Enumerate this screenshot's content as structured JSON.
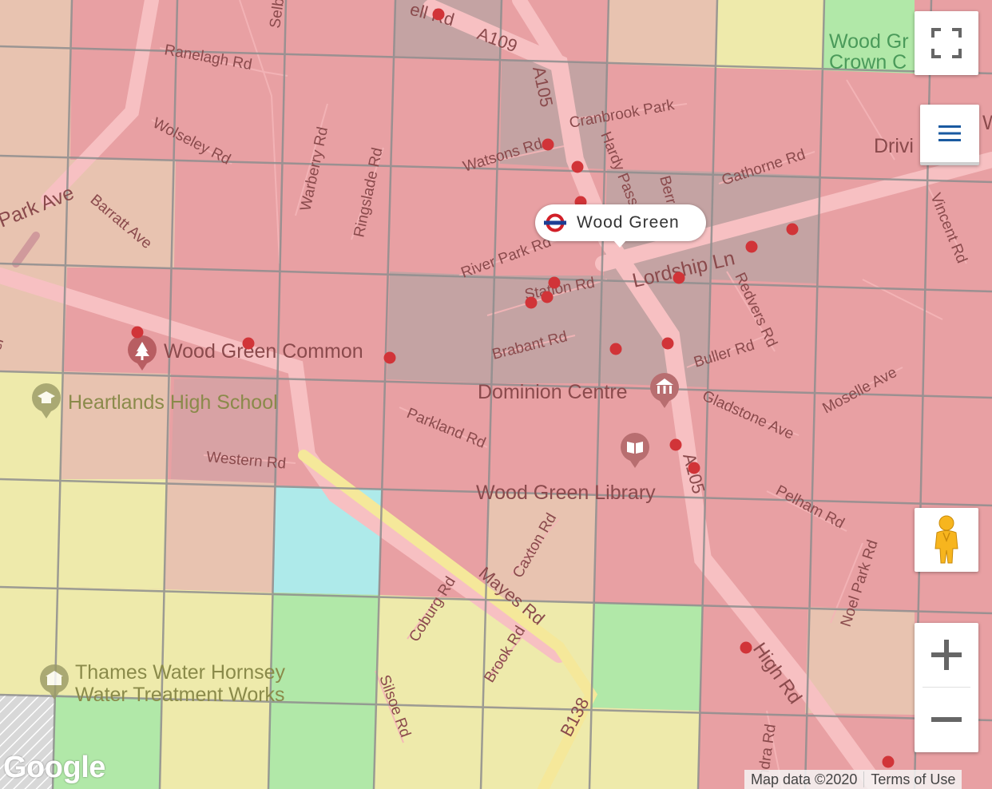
{
  "map": {
    "colors": {
      "red": "#e8a0a3",
      "dark": "#c4a3a3",
      "peach": "#e8c3b0",
      "yellow": "#eeeaab",
      "green": "#b1e8a8",
      "cyan": "#aeeaea",
      "grid": "#8e8e8e",
      "road": "#f5b9bb",
      "incident": "#d13438"
    },
    "road_labels": [
      "Ranelagh Rd",
      "Wolseley Rd",
      "Park Ave",
      "Barratt Ave",
      "Warberry Rd",
      "Ringslade Rd",
      "A109",
      "A105",
      "Cranbrook Park",
      "Watsons Rd",
      "Hardy Pass",
      "Gathorne Rd",
      "River Park Rd",
      "Station Rd",
      "Lordship Ln",
      "Redvers Rd",
      "Brabant Rd",
      "Buller Rd",
      "Gladstone Ave",
      "Moselle Ave",
      "Vincent Rd",
      "Parkland Rd",
      "Western Rd",
      "A105",
      "Pelham Rd",
      "Caxton Rd",
      "Mayes Rd",
      "Coburg Rd",
      "Noel Park Rd",
      "Brook Rd",
      "B138",
      "Silsoe Rd",
      "High Rd",
      "andra Rd",
      "Selb",
      "ell Rd",
      "Berr",
      "Drivi",
      "er"
    ],
    "poi_labels": {
      "wood_green_common": "Wood Green Common",
      "heartlands": "Heartlands High School",
      "dominion": "Dominion Centre",
      "library": "Wood Green Library",
      "thames_line1": "Thames Water Hornsey",
      "thames_line2": "Water Treatment Works",
      "crown_line1": "Wood Gr",
      "crown_line2": "Crown C",
      "right_edge": "Wood"
    },
    "icons": [
      "park-pin-icon",
      "school-pin-icon",
      "theatre-pin-icon",
      "library-pin-icon",
      "facility-pin-icon",
      "underground-roundel-icon"
    ]
  },
  "station": {
    "name": "Wood Green"
  },
  "controls": {
    "fullscreen": "fullscreen-icon",
    "layers": "menu-icon",
    "pegman": "pegman-icon",
    "zoom_in": "+",
    "zoom_out": "−"
  },
  "attribution": {
    "logo": "Google",
    "map_data": "Map data ©2020",
    "terms": "Terms of Use"
  }
}
